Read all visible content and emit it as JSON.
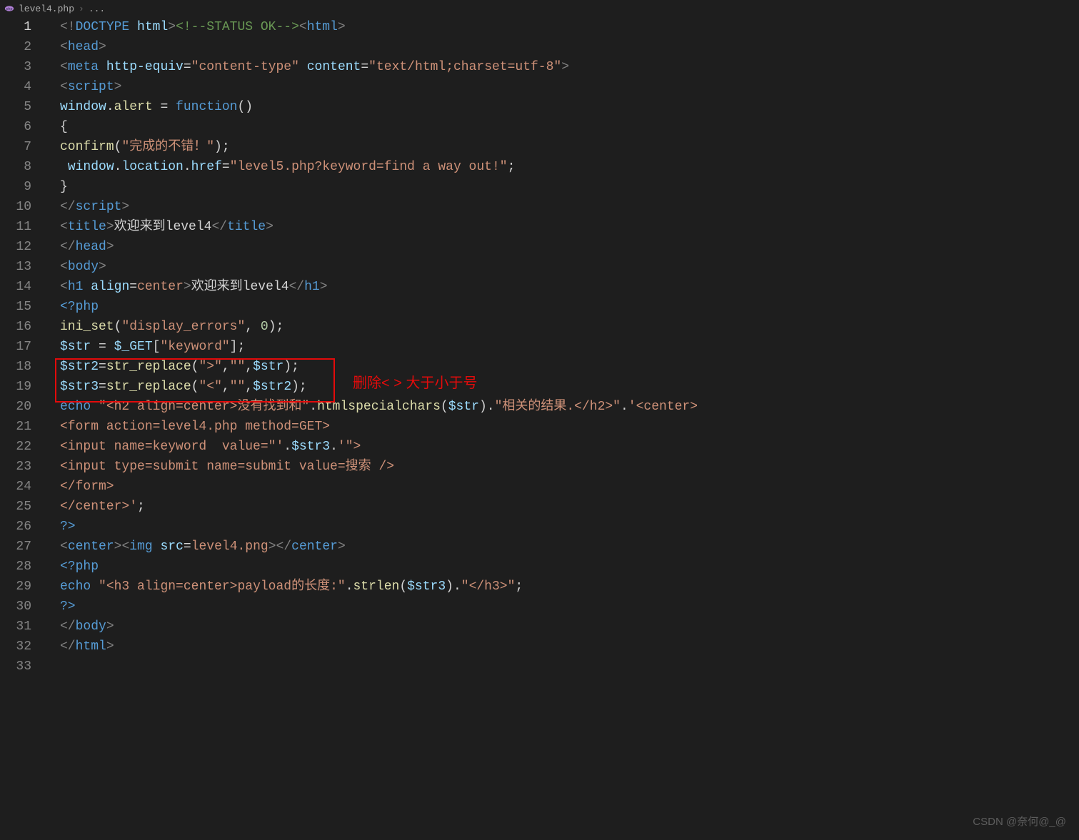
{
  "tab": {
    "filename": "level4.php",
    "breadcrumb": "..."
  },
  "lineNumbers": [
    "1",
    "2",
    "3",
    "4",
    "5",
    "6",
    "7",
    "8",
    "9",
    "10",
    "11",
    "12",
    "13",
    "14",
    "15",
    "16",
    "17",
    "18",
    "19",
    "20",
    "21",
    "22",
    "23",
    "24",
    "25",
    "26",
    "27",
    "28",
    "29",
    "30",
    "31",
    "32",
    "33"
  ],
  "activeLine": "1",
  "annotation": "删除< > 大于小于号",
  "watermark": "CSDN @奈何@_@",
  "code": {
    "l1": {
      "doctype_open": "<!",
      "doctype": "DOCTYPE",
      "html": " html",
      "doctype_close": ">",
      "cmt": "<!--STATUS OK-->",
      "html_open": "<",
      "html_tag": "html",
      "html_close": ">"
    },
    "l2": {
      "open": "<",
      "tag": "head",
      "close": ">"
    },
    "l3": {
      "open": "<",
      "tag": "meta",
      "sp": " ",
      "a1": "http-equiv",
      "eq": "=",
      "v1": "\"content-type\"",
      "sp2": " ",
      "a2": "content",
      "v2": "\"text/html;charset=utf-8\"",
      "close": ">"
    },
    "l4": {
      "open": "<",
      "tag": "script",
      "close": ">"
    },
    "l5": {
      "obj": "window",
      "dot": ".",
      "alert": "alert",
      "sp": " = ",
      "fn": "function",
      "paren": "()",
      "sp2": "  "
    },
    "l6": {
      "brace": "{"
    },
    "l7": {
      "fn": "confirm",
      "open": "(",
      "str": "\"完成的不错！\"",
      "close": ");"
    },
    "l8": {
      "indent": " ",
      "obj": "window",
      "dot1": ".",
      "loc": "location",
      "dot2": ".",
      "href": "href",
      "eq": "=",
      "str": "\"level5.php?keyword=find a way out!\"",
      "semi": ";"
    },
    "l9": {
      "brace": "}"
    },
    "l10": {
      "open": "</",
      "tag": "script",
      "close": ">"
    },
    "l11": {
      "open": "<",
      "tag": "title",
      "close": ">",
      "text": "欢迎来到level4",
      "open2": "</",
      "tag2": "title",
      "close2": ">"
    },
    "l12": {
      "open": "</",
      "tag": "head",
      "close": ">"
    },
    "l13": {
      "open": "<",
      "tag": "body",
      "close": ">"
    },
    "l14": {
      "open": "<",
      "tag": "h1",
      "sp": " ",
      "attr": "align",
      "eq": "=",
      "val": "center",
      "close": ">",
      "text": "欢迎来到level4",
      "open2": "</",
      "tag2": "h1",
      "close2": ">"
    },
    "l15": {
      "php": "<?php"
    },
    "l16": {
      "fn": "ini_set",
      "open": "(",
      "s1": "\"display_errors\"",
      "comma": ", ",
      "n": "0",
      "close": ");"
    },
    "l17": {
      "var": "$str",
      "sp": " = ",
      "get": "$_GET",
      "open": "[",
      "s": "\"keyword\"",
      "close": "];"
    },
    "l18": {
      "var": "$str2",
      "eq": "=",
      "fn": "str_replace",
      "open": "(",
      "s1": "\">\"",
      "c1": ",",
      "s2": "\"\"",
      "c2": ",",
      "arg": "$str",
      "close": ");"
    },
    "l19": {
      "var": "$str3",
      "eq": "=",
      "fn": "str_replace",
      "open": "(",
      "s1": "\"<\"",
      "c1": ",",
      "s2": "\"\"",
      "c2": ",",
      "arg": "$str2",
      "close": ");"
    },
    "l20": {
      "kw": "echo",
      "sp": " ",
      "s1": "\"<h2 align=center>没有找到和\"",
      "dot1": ".",
      "fn": "htmlspecialchars",
      "open": "(",
      "arg": "$str",
      "close": ")",
      "dot2": ".",
      "s2": "\"相关的结果.</h2>\"",
      "dot3": ".",
      "s3": "'<center>"
    },
    "l21": {
      "s": "<form action=level4.php method=GET>"
    },
    "l22": {
      "s": "<input name=keyword  value=\"'",
      "dot": ".",
      "var": "$str3",
      "dot2": ".",
      "s2": "'\">"
    },
    "l23": {
      "s": "<input type=submit name=submit value=搜索 />"
    },
    "l24": {
      "s": "</form>"
    },
    "l25": {
      "s": "</center>'",
      "semi": ";"
    },
    "l26": {
      "php": "?>"
    },
    "l27": {
      "open": "<",
      "tag": "center",
      "close": ">",
      "open2": "<",
      "tag2": "img",
      "sp": " ",
      "attr": "src",
      "eq": "=",
      "val": "level4.png",
      "close2": ">",
      "open3": "</",
      "tag3": "center",
      "close3": ">"
    },
    "l28": {
      "php": "<?php"
    },
    "l29": {
      "kw": "echo",
      "sp": " ",
      "s1": "\"<h3 align=center>payload的长度:\"",
      "dot1": ".",
      "fn": "strlen",
      "open": "(",
      "arg": "$str3",
      "close": ")",
      "dot2": ".",
      "s2": "\"</h3>\"",
      "semi": ";"
    },
    "l30": {
      "php": "?>"
    },
    "l31": {
      "open": "</",
      "tag": "body",
      "close": ">"
    },
    "l32": {
      "open": "</",
      "tag": "html",
      "close": ">"
    }
  }
}
